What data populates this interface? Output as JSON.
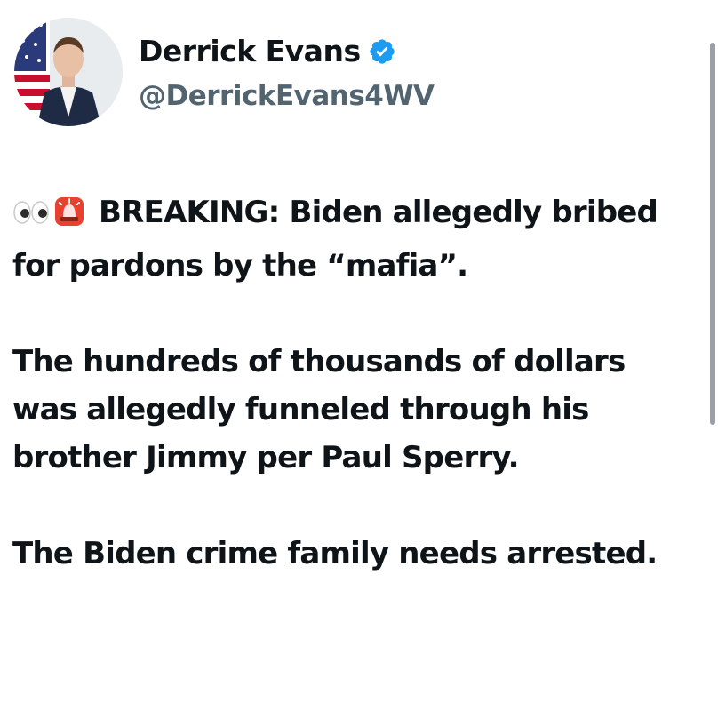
{
  "author": {
    "display_name": "Derrick Evans",
    "handle": "@DerrickEvans4WV",
    "verified": true,
    "verified_color": "#1d9bf0"
  },
  "tweet": {
    "breaking_emojis": [
      "eyes",
      "police-light"
    ],
    "line1_text": "BREAKING: Biden allegedly bribed for pardons by the “mafia”.",
    "paragraph2": "The hundreds of thousands of dollars was allegedly funneled through his brother Jimmy per Paul Sperry.",
    "paragraph3": "The Biden crime family needs arrested."
  },
  "colors": {
    "text": "#0f1419",
    "secondary_text": "#536471",
    "scrollbar": "#9aa0a6"
  }
}
